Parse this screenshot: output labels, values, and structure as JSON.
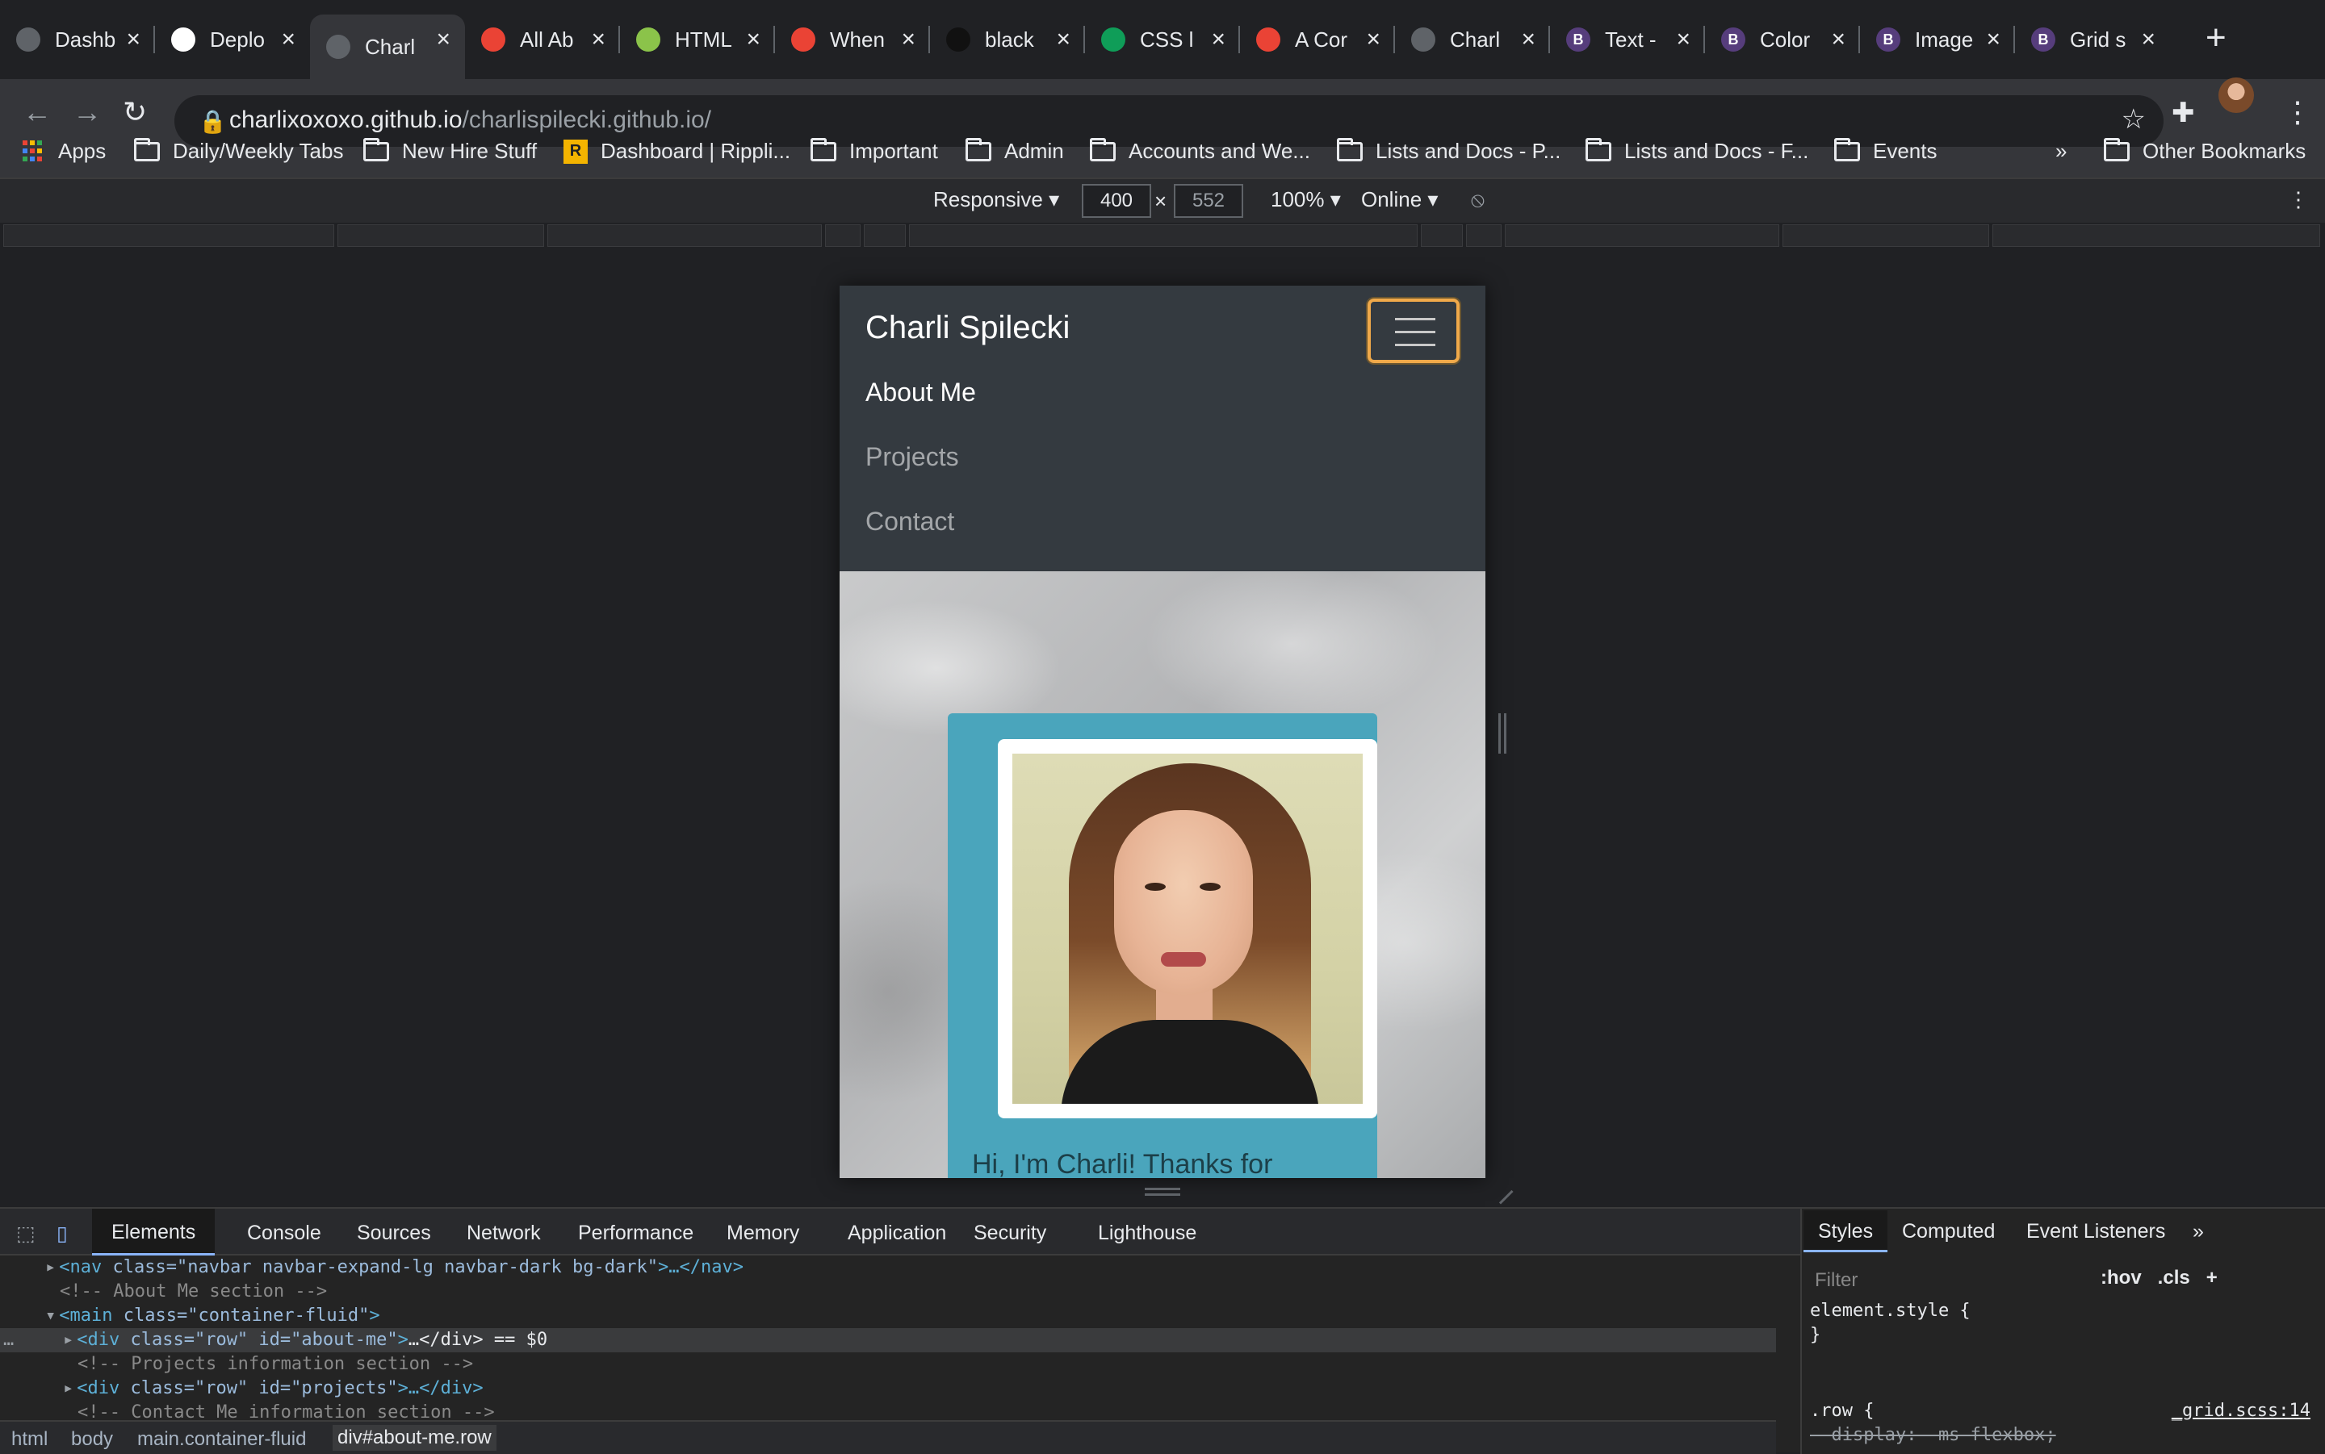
{
  "tabs": [
    {
      "title": "Dashb",
      "icon": "globe-icon",
      "color": "#5f6368"
    },
    {
      "title": "Deplo",
      "icon": "github-icon",
      "color": "#ffffff"
    },
    {
      "title": "Charl",
      "icon": "globe-icon",
      "color": "#5f6368",
      "active": true
    },
    {
      "title": "All Ab",
      "icon": "codecademy-icon",
      "color": "#ea4335"
    },
    {
      "title": "HTML",
      "icon": "html-icon",
      "color": "#8bc34a"
    },
    {
      "title": "When",
      "icon": "codecademy-icon",
      "color": "#ea4335"
    },
    {
      "title": "black",
      "icon": "black-icon",
      "color": "#111111"
    },
    {
      "title": "CSS l",
      "icon": "css-icon",
      "color": "#0f9d58"
    },
    {
      "title": "A Cor",
      "icon": "codecademy-icon",
      "color": "#ea4335"
    },
    {
      "title": "Charl",
      "icon": "globe-icon",
      "color": "#5f6368"
    },
    {
      "title": "Text -",
      "icon": "bootstrap-icon",
      "color": "#563d7c"
    },
    {
      "title": "Color",
      "icon": "bootstrap-icon",
      "color": "#563d7c"
    },
    {
      "title": "Image",
      "icon": "bootstrap-icon",
      "color": "#563d7c"
    },
    {
      "title": "Grid s",
      "icon": "bootstrap-icon",
      "color": "#563d7c"
    }
  ],
  "address_bar": {
    "host": "charlixoxoxo.github.io",
    "path": "/charlispilecki.github.io/"
  },
  "bookmarks": [
    {
      "label": "Apps",
      "icon": "apps-grid-icon"
    },
    {
      "label": "Daily/Weekly Tabs",
      "icon": "folder-icon"
    },
    {
      "label": "New Hire Stuff",
      "icon": "folder-icon"
    },
    {
      "label": "Dashboard | Rippli...",
      "icon": "rippling-icon"
    },
    {
      "label": "Important",
      "icon": "folder-icon"
    },
    {
      "label": "Admin",
      "icon": "folder-icon"
    },
    {
      "label": "Accounts and We...",
      "icon": "folder-icon"
    },
    {
      "label": "Lists and Docs - P...",
      "icon": "folder-icon"
    },
    {
      "label": "Lists and Docs - F...",
      "icon": "folder-icon"
    },
    {
      "label": "Events",
      "icon": "folder-icon"
    }
  ],
  "bookmarks_overflow": "»",
  "other_bookmarks": "Other Bookmarks",
  "device_toolbar": {
    "mode": "Responsive",
    "width": "400",
    "height": "552",
    "times": "×",
    "zoom": "100%",
    "network": "Online"
  },
  "site": {
    "brand": "Charli Spilecki",
    "nav": [
      "About Me",
      "Projects",
      "Contact"
    ],
    "greeting": "Hi, I'm Charli! Thanks for"
  },
  "devtools": {
    "tabs": [
      "Elements",
      "Console",
      "Sources",
      "Network",
      "Performance",
      "Memory",
      "Application",
      "Security",
      "Lighthouse"
    ],
    "dom_lines": [
      {
        "indent": 1,
        "arrow": "▶",
        "tag": "nav",
        "attrs": "class=\"navbar navbar-expand-lg navbar-dark bg-dark\"",
        "suffix": "…</nav>"
      },
      {
        "indent": 1,
        "comment": "<!-- About Me section -->"
      },
      {
        "indent": 1,
        "arrow": "▼",
        "tag": "main",
        "attrs": "class=\"container-fluid\"",
        "suffix": ""
      },
      {
        "indent": 2,
        "arrow": "▶",
        "tag": "div",
        "attrs": "class=\"row\" id=\"about-me\"",
        "suffix": "…</div> == $0",
        "selected": true
      },
      {
        "indent": 2,
        "comment": "<!-- Projects information section -->"
      },
      {
        "indent": 2,
        "arrow": "▶",
        "tag": "div",
        "attrs": "class=\"row\" id=\"projects\"",
        "suffix": "…</div>"
      },
      {
        "indent": 2,
        "comment": "<!-- Contact Me information section -->"
      }
    ],
    "breadcrumbs": [
      "html",
      "body",
      "main.container-fluid",
      "div#about-me.row"
    ],
    "styles_tabs": [
      "Styles",
      "Computed",
      "Event Listeners",
      "»"
    ],
    "filter_placeholder": "Filter",
    "filter_buttons": [
      ":hov",
      ".cls",
      "+"
    ],
    "css_rules": [
      "element.style {",
      "}",
      ".row {",
      "  display: -ms-flexbox;"
    ],
    "css_source": "_grid.scss:14"
  }
}
